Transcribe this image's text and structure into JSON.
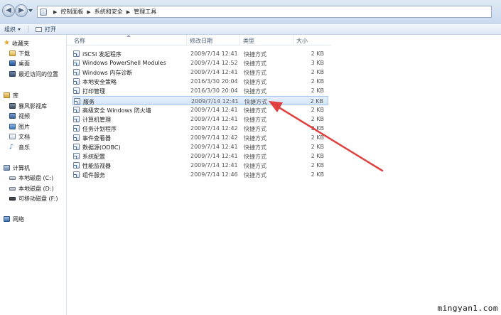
{
  "address": {
    "crumbs": [
      "控制面板",
      "系统和安全",
      "管理工具"
    ]
  },
  "toolbar": {
    "organize_label": "组织",
    "open_label": "打开"
  },
  "nav": {
    "favorites_label": "收藏夹",
    "favorites": [
      "下载",
      "桌面",
      "最近访问的位置"
    ],
    "library_label": "库",
    "library": [
      "暴风影视库",
      "视频",
      "图片",
      "文档",
      "音乐"
    ],
    "computer_label": "计算机",
    "computer": [
      "本地磁盘 (C:)",
      "本地磁盘 (D:)",
      "可移动磁盘 (F:)"
    ],
    "network_label": "网络"
  },
  "columns": {
    "name": "名称",
    "date": "修改日期",
    "type": "类型",
    "size": "大小"
  },
  "files": [
    {
      "name": "iSCSI 发起程序",
      "date": "2009/7/14 12:41",
      "type": "快捷方式",
      "size": "2 KB"
    },
    {
      "name": "Windows PowerShell Modules",
      "date": "2009/7/14 12:52",
      "type": "快捷方式",
      "size": "3 KB"
    },
    {
      "name": "Windows 内存诊断",
      "date": "2009/7/14 12:41",
      "type": "快捷方式",
      "size": "2 KB"
    },
    {
      "name": "本地安全策略",
      "date": "2016/3/30 20:04",
      "type": "快捷方式",
      "size": "2 KB"
    },
    {
      "name": "打印管理",
      "date": "2016/3/30 20:04",
      "type": "快捷方式",
      "size": "2 KB"
    },
    {
      "name": "服务",
      "date": "2009/7/14 12:41",
      "type": "快捷方式",
      "size": "2 KB"
    },
    {
      "name": "高级安全 Windows 防火墙",
      "date": "2009/7/14 12:41",
      "type": "快捷方式",
      "size": "2 KB"
    },
    {
      "name": "计算机管理",
      "date": "2009/7/14 12:41",
      "type": "快捷方式",
      "size": "2 KB"
    },
    {
      "name": "任务计划程序",
      "date": "2009/7/14 12:42",
      "type": "快捷方式",
      "size": "2 KB"
    },
    {
      "name": "事件查看器",
      "date": "2009/7/14 12:42",
      "type": "快捷方式",
      "size": "2 KB"
    },
    {
      "name": "数据源(ODBC)",
      "date": "2009/7/14 12:41",
      "type": "快捷方式",
      "size": "2 KB"
    },
    {
      "name": "系统配置",
      "date": "2009/7/14 12:41",
      "type": "快捷方式",
      "size": "2 KB"
    },
    {
      "name": "性能监视器",
      "date": "2009/7/14 12:41",
      "type": "快捷方式",
      "size": "2 KB"
    },
    {
      "name": "组件服务",
      "date": "2009/7/14 12:46",
      "type": "快捷方式",
      "size": "2 KB"
    }
  ],
  "selected_index": 5,
  "annotation_color": "#e0403f",
  "watermark": "mingyan1.com"
}
